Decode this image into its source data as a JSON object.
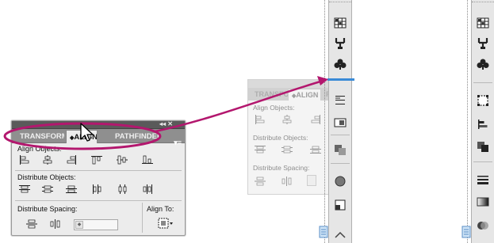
{
  "panel": {
    "tabs": [
      "TRANSFORM",
      "ALIGN",
      "PATHFINDER"
    ],
    "active_tab": "ALIGN",
    "window_controls": "◂◂  ✕",
    "menu_icon": "menu-icon",
    "align_objects_label": "Align Objects:",
    "distribute_objects_label": "Distribute Objects:",
    "distribute_spacing_label": "Distribute Spacing:",
    "align_to_label": "Align To:",
    "spacing_value": ""
  },
  "ghost_panel": {
    "tabs": [
      "TRANSFORM",
      "ALIGN",
      "PAT"
    ],
    "align_objects_label": "Align Objects:",
    "distribute_objects_label": "Distribute Objects:",
    "distribute_spacing_label": "Distribute Spacing:"
  },
  "dock_middle": {
    "icons": [
      "swatches-icon",
      "brushes-icon",
      "symbols-icon",
      "align-icon",
      "transform-icon",
      "pathfinder-icon",
      "appearance-icon",
      "layers-icon",
      "artboards-icon"
    ]
  },
  "dock_right": {
    "icons": [
      "swatches-icon",
      "brushes-icon",
      "symbols-icon",
      "transform-icon",
      "align-icon",
      "pathfinder-icon",
      "stroke-icon",
      "gradient-icon",
      "transparency-icon",
      "appearance-icon"
    ]
  },
  "colors": {
    "highlight_ellipse": "#b3176e",
    "drop_indicator": "#3a8ad6",
    "panel_bg": "#ececec",
    "tab_bar": "#8f8f8f"
  }
}
